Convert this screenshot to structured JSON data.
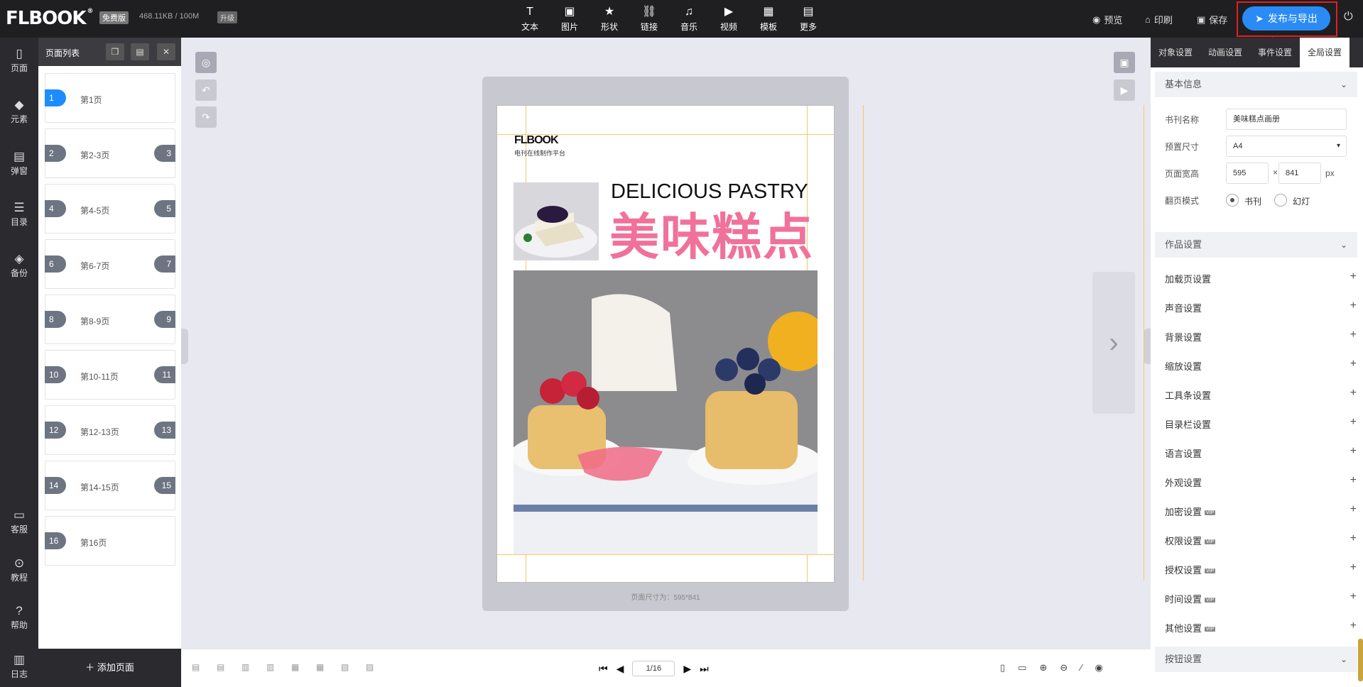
{
  "topbar": {
    "logo": "FLBOOK",
    "badge_free": "免费版",
    "storage": "468.11KB / 100M",
    "badge_upgrade": "升级",
    "tools": [
      {
        "icon": "text-icon",
        "glyph": "T",
        "label": "文本"
      },
      {
        "icon": "image-icon",
        "glyph": "▣",
        "label": "图片"
      },
      {
        "icon": "star-icon",
        "glyph": "★",
        "label": "形状"
      },
      {
        "icon": "link-icon",
        "glyph": "⛓",
        "label": "链接"
      },
      {
        "icon": "music-icon",
        "glyph": "♫",
        "label": "音乐"
      },
      {
        "icon": "video-icon",
        "glyph": "▶",
        "label": "视频"
      },
      {
        "icon": "template-icon",
        "glyph": "▦",
        "label": "模板"
      },
      {
        "icon": "more-icon",
        "glyph": "▤",
        "label": "更多"
      }
    ],
    "preview": "预览",
    "print": "印刷",
    "save": "保存",
    "publish": "发布与导出"
  },
  "iconbar": [
    {
      "icon": "page-icon",
      "glyph": "▯",
      "label": "页面"
    },
    {
      "icon": "element-icon",
      "glyph": "◆",
      "label": "元素"
    },
    {
      "icon": "popup-icon",
      "glyph": "▤",
      "label": "弹窗"
    },
    {
      "icon": "toc-icon",
      "glyph": "☰",
      "label": "目录"
    },
    {
      "icon": "backup-icon",
      "glyph": "◈",
      "label": "备份"
    },
    {
      "icon": "service-icon",
      "glyph": "▭",
      "label": "客服"
    },
    {
      "icon": "tutorial-icon",
      "glyph": "⊙",
      "label": "教程"
    },
    {
      "icon": "help-icon",
      "glyph": "?",
      "label": "帮助"
    },
    {
      "icon": "log-icon",
      "glyph": "▥",
      "label": "日志"
    }
  ],
  "pagelist": {
    "title": "页面列表",
    "pages": [
      {
        "left": "1",
        "right": "",
        "label": "第1页"
      },
      {
        "left": "2",
        "right": "3",
        "label": "第2-3页"
      },
      {
        "left": "4",
        "right": "5",
        "label": "第4-5页"
      },
      {
        "left": "6",
        "right": "7",
        "label": "第6-7页"
      },
      {
        "left": "8",
        "right": "9",
        "label": "第8-9页"
      },
      {
        "left": "10",
        "right": "11",
        "label": "第10-11页"
      },
      {
        "left": "12",
        "right": "13",
        "label": "第12-13页"
      },
      {
        "left": "14",
        "right": "15",
        "label": "第14-15页"
      },
      {
        "left": "16",
        "right": "",
        "label": "第16页"
      }
    ],
    "add_page": "添加页面"
  },
  "canvas": {
    "paper_logo": "FLBOOK",
    "paper_sub": "电刊在线制作平台",
    "title_en": "DELICIOUS PASTRY",
    "title_cn": "美味糕点",
    "dim_label": "页面尺寸为：595*841"
  },
  "bottombar": {
    "page_indicator": "1/16"
  },
  "rpanel": {
    "tabs": [
      "对象设置",
      "动画设置",
      "事件设置",
      "全局设置"
    ],
    "basic": "基本信息",
    "book_name_label": "书刊名称",
    "book_name_value": "美味糕点画册",
    "preset_label": "预置尺寸",
    "preset_value": "A4",
    "size_label": "页面宽高",
    "width": "595",
    "height": "841",
    "times": "×",
    "unit": "px",
    "flip_label": "翻页模式",
    "flip_book": "书刊",
    "flip_slide": "幻灯",
    "works": "作品设置",
    "items": [
      {
        "label": "加载页设置",
        "vip": ""
      },
      {
        "label": "声音设置",
        "vip": ""
      },
      {
        "label": "背景设置",
        "vip": ""
      },
      {
        "label": "缩放设置",
        "vip": ""
      },
      {
        "label": "工具条设置",
        "vip": ""
      },
      {
        "label": "目录栏设置",
        "vip": ""
      },
      {
        "label": "语言设置",
        "vip": ""
      },
      {
        "label": "外观设置",
        "vip": ""
      },
      {
        "label": "加密设置",
        "vip": "VIP"
      },
      {
        "label": "权限设置",
        "vip": "VIP"
      },
      {
        "label": "授权设置",
        "vip": "VIP"
      },
      {
        "label": "时间设置",
        "vip": "VIP"
      },
      {
        "label": "其他设置",
        "vip": "VIP"
      }
    ],
    "buttons": "按钮设置"
  }
}
